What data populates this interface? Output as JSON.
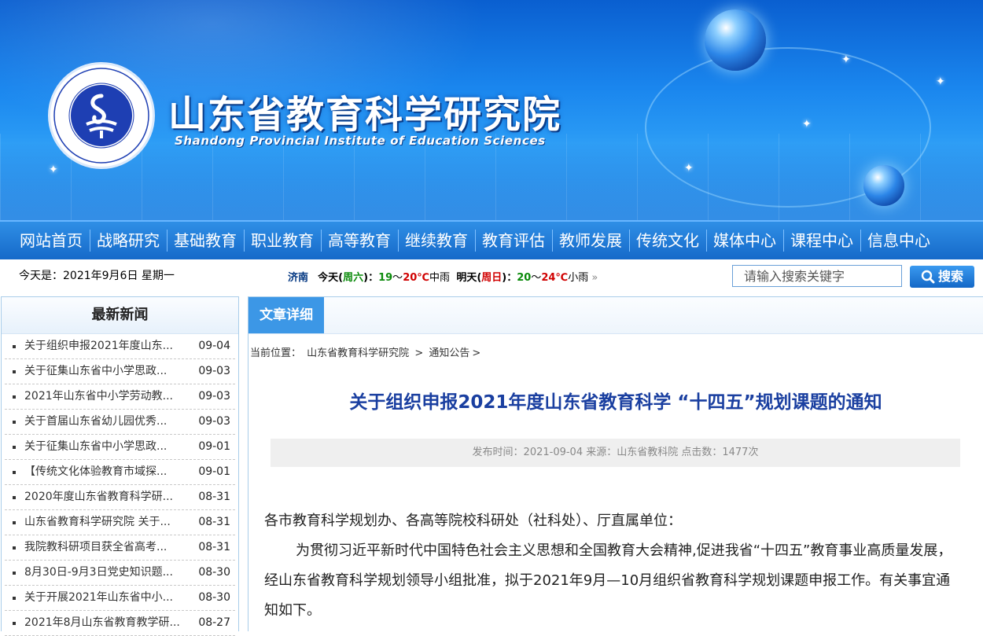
{
  "site": {
    "title": "山东省教育科学研究院",
    "subtitle": "Shandong Provincial Institute of Education Sciences",
    "seal_text": "山东省教育科学研究院",
    "seal_text_en": "Shandong Provincial Institute of Education Sciences"
  },
  "nav": {
    "items": [
      "网站首页",
      "战略研究",
      "基础教育",
      "职业教育",
      "高等教育",
      "继续教育",
      "教育评估",
      "教师发展",
      "传统文化",
      "媒体中心",
      "课程中心",
      "信息中心"
    ]
  },
  "infobar": {
    "today_label": "今天是：2021年9月6日 星期一",
    "weather": {
      "city": "济南",
      "today_prefix": "今天(",
      "today_day": "周六",
      "today_suffix": ")：",
      "today_low": "19",
      "tilde": "〜",
      "today_high": "20℃",
      "today_cond": "中雨",
      "tomorrow_prefix": "明天(",
      "tomorrow_day": "周日",
      "tomorrow_suffix": ")：",
      "tomorrow_low": "20",
      "tomorrow_high": "24℃",
      "tomorrow_cond": "小雨",
      "more": "»"
    },
    "search_placeholder": "请输入搜索关键字",
    "search_button": "搜索"
  },
  "sidebar": {
    "title": "最新新闻",
    "items": [
      {
        "title": "关于组织申报2021年度山东...",
        "date": "09-04"
      },
      {
        "title": "关于征集山东省中小学思政...",
        "date": "09-03"
      },
      {
        "title": "2021年山东省中小学劳动教...",
        "date": "09-03"
      },
      {
        "title": "关于首届山东省幼儿园优秀...",
        "date": "09-03"
      },
      {
        "title": "关于征集山东省中小学思政...",
        "date": "09-01"
      },
      {
        "title": "【传统文化体验教育市域探...",
        "date": "09-01"
      },
      {
        "title": "2020年度山东省教育科学研...",
        "date": "08-31"
      },
      {
        "title": "山东省教育科学研究院 关于...",
        "date": "08-31"
      },
      {
        "title": "我院教科研项目获全省高考...",
        "date": "08-31"
      },
      {
        "title": "8月30日-9月3日党史知识题...",
        "date": "08-30"
      },
      {
        "title": "关于开展2021年山东省中小...",
        "date": "08-30"
      },
      {
        "title": "2021年8月山东省教育教学研...",
        "date": "08-27"
      }
    ]
  },
  "main": {
    "tab": "文章详细",
    "crumb_label": "当前位置：",
    "crumb_home": "山东省教育科学研究院",
    "crumb_sep": ">",
    "crumb_section": "通知公告",
    "crumb_end": ">",
    "title": "关于组织申报2021年度山东省教育科学 “十四五”规划课题的通知",
    "meta": "发布时间：2021-09-04 来源：山东省教科院 点击数：1477次",
    "salutation": "各市教育科学规划办、各高等院校科研处（社科处）、厅直属单位：",
    "paragraph": "为贯彻习近平新时代中国特色社会主义思想和全国教育大会精神,促进我省“十四五”教育事业高质量发展，经山东省教育科学规划领导小组批准，拟于2021年9月—10月组织省教育科学规划课题申报工作。有关事宜通知如下。"
  },
  "colors": {
    "banner_blue": "#1a86ee",
    "nav_blue": "#1669c9",
    "title_blue": "#1a3fa0",
    "weekend_green": "#0a8a0a",
    "temp_red": "#d00000"
  }
}
